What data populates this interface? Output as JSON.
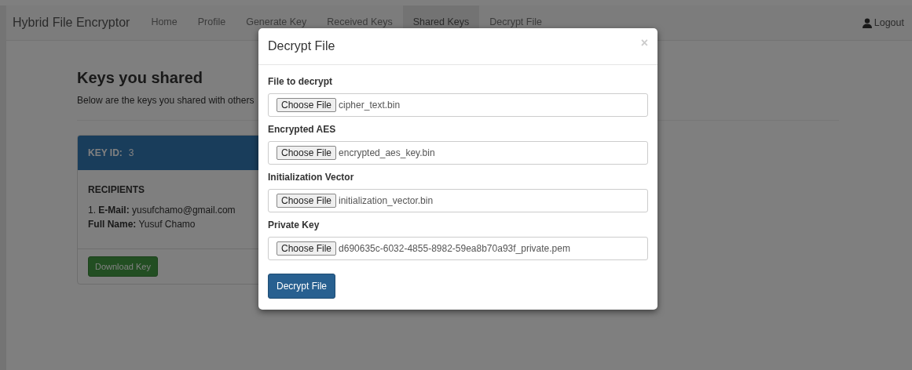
{
  "navbar": {
    "brand": "Hybrid File Encryptor",
    "items": [
      {
        "label": "Home",
        "selected": false
      },
      {
        "label": "Profile",
        "selected": false
      },
      {
        "label": "Generate Key",
        "selected": false
      },
      {
        "label": "Received Keys",
        "selected": false
      },
      {
        "label": "Shared Keys",
        "selected": true
      },
      {
        "label": "Decrypt File",
        "selected": false
      }
    ],
    "logout": "Logout"
  },
  "page": {
    "heading": "Keys you shared",
    "subtitle": "Below are the keys you shared with others"
  },
  "key_card": {
    "key_id_label": "KEY ID:",
    "key_id": "3",
    "recipients_title": "RECIPIENTS",
    "recipients": [
      {
        "index": "1.",
        "email_label": "E-Mail:",
        "email": "yusufchamo@gmail.com",
        "name_label": "Full Name:",
        "name": "Yusuf Chamo"
      }
    ],
    "download_button": "Download Key"
  },
  "modal": {
    "title": "Decrypt File",
    "close": "×",
    "fields": [
      {
        "label": "File to decrypt",
        "button": "Choose File",
        "file": "cipher_text.bin"
      },
      {
        "label": "Encrypted AES",
        "button": "Choose File",
        "file": "encrypted_aes_key.bin"
      },
      {
        "label": "Initialization Vector",
        "button": "Choose File",
        "file": "initialization_vector.bin"
      },
      {
        "label": "Private Key",
        "button": "Choose File",
        "file": "d690635c-6032-4855-8982-59ea8b70a93f_private.pem"
      }
    ],
    "submit": "Decrypt File"
  }
}
